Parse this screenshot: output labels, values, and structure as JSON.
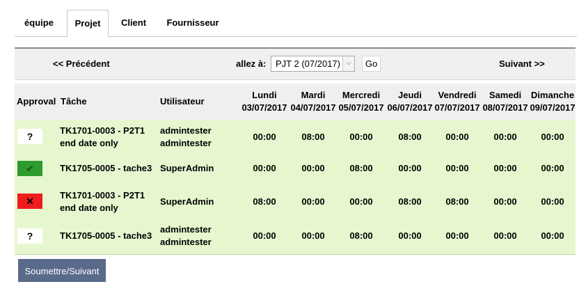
{
  "tabs": [
    {
      "label": "équipe"
    },
    {
      "label": "Projet"
    },
    {
      "label": "Client"
    },
    {
      "label": "Fournisseur"
    }
  ],
  "active_tab": "Projet",
  "nav": {
    "prev_label": "<< Précédent",
    "goto_label": "allez à:",
    "select_value": "PJT 2 (07/2017)",
    "go_label": "Go",
    "next_label": "Suivant >>"
  },
  "table": {
    "headers": {
      "approval": "Approval",
      "task": "Tâche",
      "user": "Utilisateur"
    },
    "days": [
      {
        "name": "Lundi",
        "date": "03/07/2017"
      },
      {
        "name": "Mardi",
        "date": "04/07/2017"
      },
      {
        "name": "Mercredi",
        "date": "05/07/2017"
      },
      {
        "name": "Jeudi",
        "date": "06/07/2017"
      },
      {
        "name": "Vendredi",
        "date": "07/07/2017"
      },
      {
        "name": "Samedi",
        "date": "08/07/2017"
      },
      {
        "name": "Dimanche",
        "date": "09/07/2017"
      }
    ],
    "rows": [
      {
        "approval": "?",
        "approval_state": "unknown",
        "task": "TK1701-0003 - P2T1 end date only",
        "user": "admintester admintester",
        "hours": [
          "00:00",
          "08:00",
          "00:00",
          "08:00",
          "00:00",
          "00:00",
          "00:00"
        ]
      },
      {
        "approval": "✔",
        "approval_state": "approved",
        "task": "TK1705-0005 - tache3",
        "user": "SuperAdmin",
        "hours": [
          "00:00",
          "00:00",
          "08:00",
          "00:00",
          "00:00",
          "00:00",
          "00:00"
        ]
      },
      {
        "approval": "✕",
        "approval_state": "rejected",
        "task": "TK1701-0003 - P2T1 end date only",
        "user": "SuperAdmin",
        "hours": [
          "08:00",
          "00:00",
          "00:00",
          "08:00",
          "08:00",
          "00:00",
          "00:00"
        ]
      },
      {
        "approval": "?",
        "approval_state": "unknown",
        "task": "TK1705-0005 - tache3",
        "user": "admintester admintester",
        "hours": [
          "00:00",
          "00:00",
          "08:00",
          "00:00",
          "00:00",
          "00:00",
          "00:00"
        ]
      }
    ]
  },
  "submit_label": "Soumettre/Suivant",
  "colors": {
    "row_background": "#e6f7cf",
    "header_background": "#efefef",
    "approved": "#2e9b2e",
    "rejected": "#ee1c1c",
    "submit_button": "#5a6a8a"
  }
}
